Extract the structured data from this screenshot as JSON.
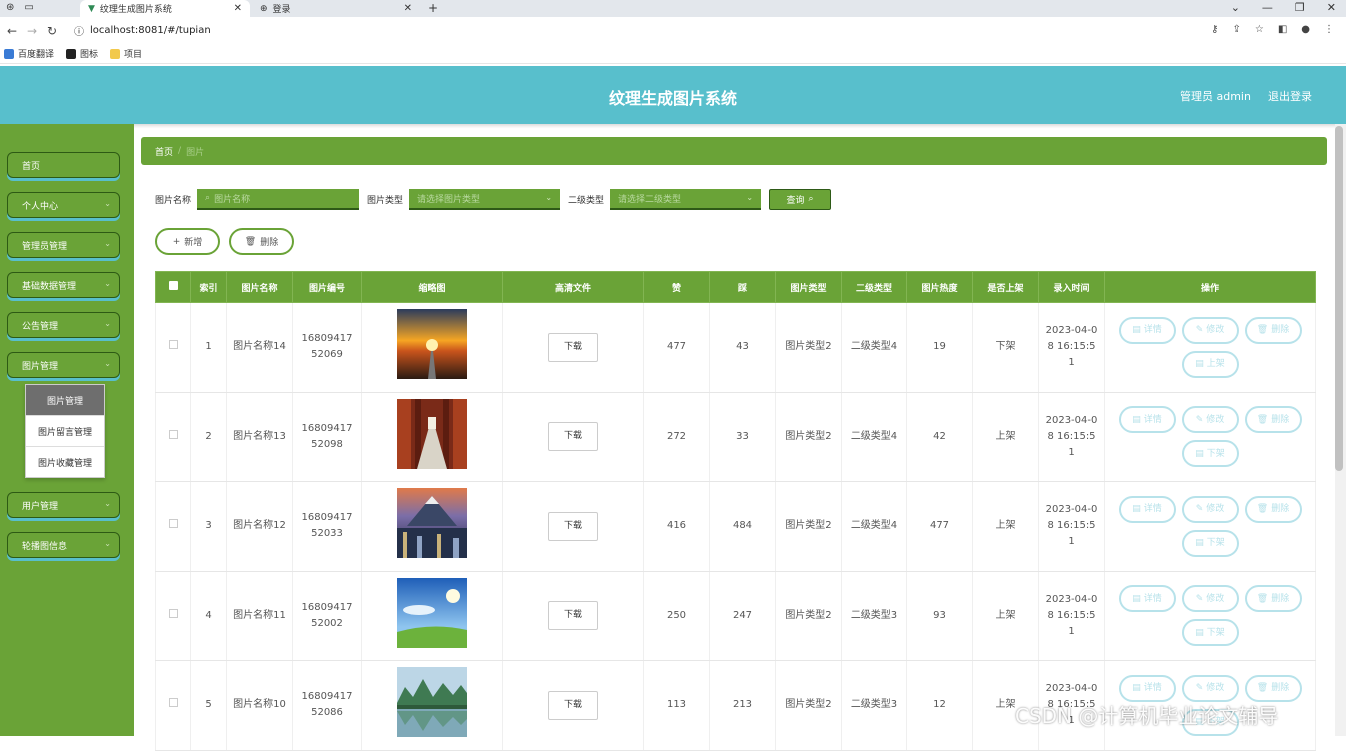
{
  "browser": {
    "tabs": [
      {
        "title": "纹理生成图片系统"
      },
      {
        "title": "登录"
      }
    ],
    "url": "localhost:8081/#/tupian",
    "bookmarks": [
      "百度翻译",
      "图标",
      "项目"
    ]
  },
  "header": {
    "title": "纹理生成图片系统",
    "admin": "管理员 admin",
    "logout": "退出登录",
    "color": "#58bfcc"
  },
  "sidebar": {
    "color": "#6aa337",
    "items": [
      {
        "label": "首页"
      },
      {
        "label": "个人中心"
      },
      {
        "label": "管理员管理"
      },
      {
        "label": "基础数据管理"
      },
      {
        "label": "公告管理"
      },
      {
        "label": "图片管理"
      },
      {
        "label": "用户管理"
      },
      {
        "label": "轮播图信息"
      }
    ],
    "submenu": [
      "图片管理",
      "图片留言管理",
      "图片收藏管理"
    ]
  },
  "breadcrumb": {
    "home": "首页",
    "sep": "/",
    "current": "图片"
  },
  "search": {
    "name_label": "图片名称",
    "name_placeholder": "图片名称",
    "type_label": "图片类型",
    "type_placeholder": "请选择图片类型",
    "subtype_label": "二级类型",
    "subtype_placeholder": "请选择二级类型",
    "query": "查询"
  },
  "actions": {
    "add": "新增",
    "delete": "删除"
  },
  "table": {
    "headers": [
      "索引",
      "图片名称",
      "图片编号",
      "缩略图",
      "高清文件",
      "赞",
      "踩",
      "图片类型",
      "二级类型",
      "图片热度",
      "是否上架",
      "录入时间",
      "操作"
    ],
    "download": "下载",
    "ops": {
      "detail": "详情",
      "edit": "修改",
      "delete": "删除"
    },
    "rows": [
      {
        "idx": "1",
        "name": "图片名称14",
        "code": "1680941752069",
        "like": "477",
        "dislike": "43",
        "type": "图片类型2",
        "subtype": "二级类型4",
        "heat": "19",
        "status": "下架",
        "time": "2023-04-08 16:15:51",
        "toggle": "上架"
      },
      {
        "idx": "2",
        "name": "图片名称13",
        "code": "1680941752098",
        "like": "272",
        "dislike": "33",
        "type": "图片类型2",
        "subtype": "二级类型4",
        "heat": "42",
        "status": "上架",
        "time": "2023-04-08 16:15:51",
        "toggle": "下架"
      },
      {
        "idx": "3",
        "name": "图片名称12",
        "code": "1680941752033",
        "like": "416",
        "dislike": "484",
        "type": "图片类型2",
        "subtype": "二级类型4",
        "heat": "477",
        "status": "上架",
        "time": "2023-04-08 16:15:51",
        "toggle": "下架"
      },
      {
        "idx": "4",
        "name": "图片名称11",
        "code": "1680941752002",
        "like": "250",
        "dislike": "247",
        "type": "图片类型2",
        "subtype": "二级类型3",
        "heat": "93",
        "status": "上架",
        "time": "2023-04-08 16:15:51",
        "toggle": "下架"
      },
      {
        "idx": "5",
        "name": "图片名称10",
        "code": "1680941752086",
        "like": "113",
        "dislike": "213",
        "type": "图片类型2",
        "subtype": "二级类型3",
        "heat": "12",
        "status": "上架",
        "time": "2023-04-08 16:15:51",
        "toggle": "下架"
      }
    ]
  },
  "watermark": "CSDN @计算机毕业论文辅导"
}
